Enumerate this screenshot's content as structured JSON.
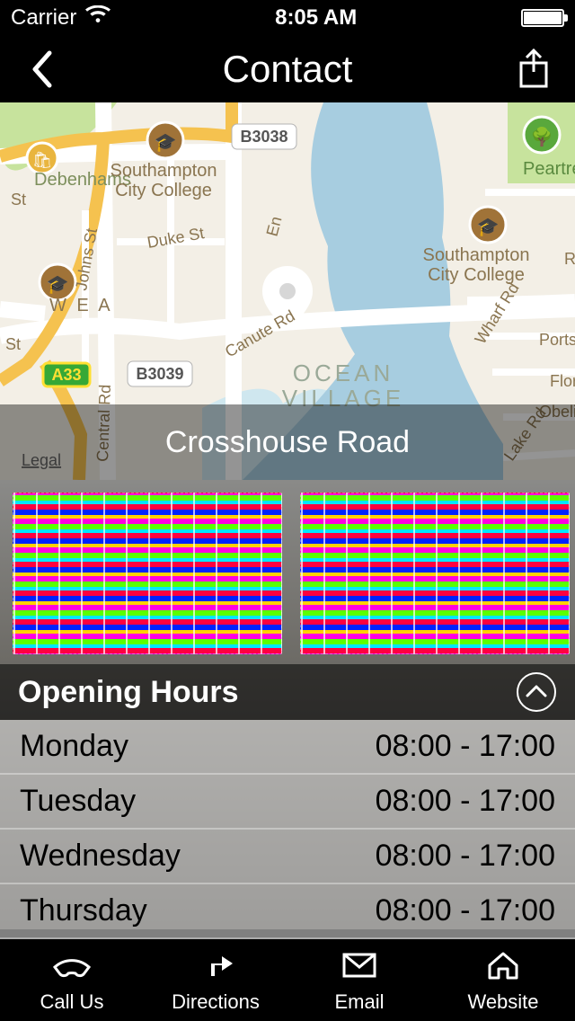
{
  "status": {
    "carrier": "Carrier",
    "time": "8:05 AM"
  },
  "nav": {
    "title": "Contact"
  },
  "map": {
    "caption": "Crosshouse Road",
    "labels": {
      "debenhams": "Debenhams",
      "scc1": "Southampton\nCity College",
      "scc2": "Southampton\nCity College",
      "wea": "W E A",
      "peartree": "Peartree Gre",
      "ocean": "OCEAN\nVILLAGE",
      "b3038": "B3038",
      "b3039": "B3039",
      "a33": "A33",
      "st_left": "St",
      "st_left2": "St",
      "duke": "Duke St",
      "johns": "Johns St",
      "canute": "Canute Rd",
      "centralrd": "Central Rd",
      "en": "En",
      "wharf": "Wharf Rd",
      "lake": "Lake Rd",
      "obelisk": "Obelisk",
      "flore": "Flore",
      "portsm": "Portsm",
      "r_right": "R",
      "legal": "Legal"
    }
  },
  "hours": {
    "title": "Opening Hours",
    "items": [
      {
        "day": "Monday",
        "time": "08:00 - 17:00"
      },
      {
        "day": "Tuesday",
        "time": "08:00 - 17:00"
      },
      {
        "day": "Wednesday",
        "time": "08:00 - 17:00"
      },
      {
        "day": "Thursday",
        "time": "08:00 - 17:00"
      }
    ]
  },
  "tabs": {
    "call": "Call Us",
    "directions": "Directions",
    "email": "Email",
    "website": "Website"
  }
}
